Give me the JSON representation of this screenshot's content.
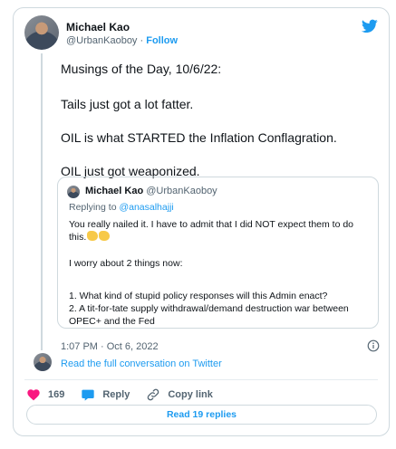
{
  "tweet": {
    "author": {
      "name": "Michael Kao",
      "handle": "@UrbanKaoboy",
      "separator": "·",
      "follow_label": "Follow"
    },
    "lines": [
      "Musings of the Day, 10/6/22:",
      "Tails just got a lot fatter.",
      "OIL is what STARTED the Inflation Conflagration.",
      "OIL just got weaponized."
    ],
    "quoted": {
      "name": "Michael Kao",
      "handle": "@UrbanKaoboy",
      "replying_prefix": "Replying to",
      "replying_to": "@anasalhajji",
      "paragraph1": "You really nailed it. I have to admit that I did NOT expect them to do this.",
      "paragraph2": "I worry about 2 things now:",
      "item1": "1. What kind of stupid policy responses will this Admin enact?",
      "item2": "2. A tit-for-tate supply withdrawal/demand destruction war between OPEC+ and the Fed"
    },
    "timestamp": "1:07 PM · Oct 6, 2022",
    "read_full_label": "Read the full conversation on Twitter",
    "likes": "169",
    "reply_label": "Reply",
    "copy_link_label": "Copy link",
    "read_replies_label": "Read 19 replies",
    "colors": {
      "accent": "#1d9bf0",
      "like": "#f91880",
      "text": "#0f1419",
      "muted": "#536471",
      "border": "#cfd9de"
    },
    "icons": [
      "twitter-bird-icon",
      "info-icon",
      "heart-icon",
      "reply-bubble-icon",
      "link-icon",
      "clapping-hands-emoji"
    ]
  }
}
